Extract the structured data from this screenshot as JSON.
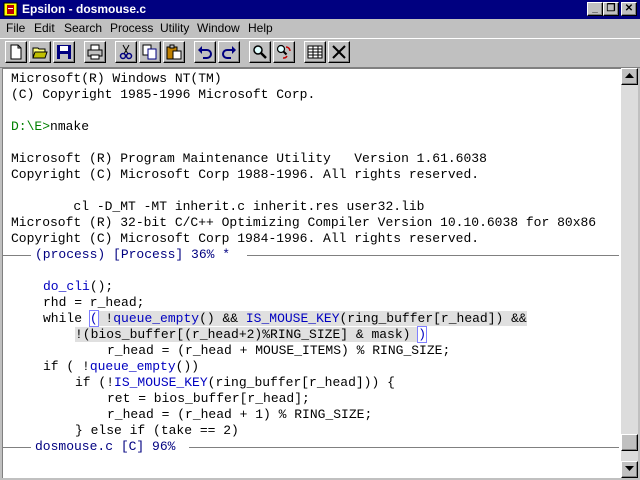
{
  "window": {
    "title": "Epsilon - dosmouse.c",
    "minimize_glyph": "_",
    "restore_glyph": "❐",
    "close_glyph": "✕"
  },
  "menu": [
    "File",
    "Edit",
    "Search",
    "Process",
    "Utility",
    "Window",
    "Help"
  ],
  "toolbar": {
    "buttons": [
      "new-file",
      "open-folder",
      "save",
      "print",
      "cut",
      "copy",
      "paste",
      "undo",
      "redo",
      "find",
      "find-replace",
      "columns",
      "close"
    ]
  },
  "process_buffer": {
    "lines": [
      "Microsoft(R) Windows NT(TM)",
      "(C) Copyright 1985-1996 Microsoft Corp.",
      "",
      "D:\\E>nmake",
      "",
      "Microsoft (R) Program Maintenance Utility   Version 1.61.6038",
      "Copyright (C) Microsoft Corp 1988-1996. All rights reserved.",
      "",
      "        cl -D_MT -MT inherit.c inherit.res user32.lib",
      "Microsoft (R) 32-bit C/C++ Optimizing Compiler Version 10.10.6038 for 80x86",
      "Copyright (C) Microsoft Corp 1984-1996. All rights reserved."
    ],
    "prompt": "D:\\E>",
    "command": "nmake",
    "mode_line": "(process) [Process] 36% *"
  },
  "source_buffer": {
    "mode_line": "dosmouse.c [C] 96%"
  },
  "code": {
    "l0_kw": "do_cli",
    "l0_rest": "();",
    "l1": "rhd = r_head;",
    "l2_a": "while ",
    "l2_b": "(",
    "l2_c": " !",
    "l2_d": "queue_empty",
    "l2_e": "() && ",
    "l2_f": "IS_MOUSE_KEY",
    "l2_g": "(ring_buffer[r_head]) &&",
    "l3_a": "!(bios_buffer[(r_head+2)%RING_SIZE] & mask) ",
    "l3_b": ")",
    "l4": "r_head = (r_head + MOUSE_ITEMS) % RING_SIZE;",
    "l5_a": "if ( !",
    "l5_b": "queue_empty",
    "l5_c": "())",
    "l6_a": "if (!",
    "l6_b": "IS_MOUSE_KEY",
    "l6_c": "(ring_buffer[r_head])) {",
    "l7": "ret = bios_buffer[r_head];",
    "l8": "r_head = (r_head + 1) % RING_SIZE;",
    "l9": "} else if (take == 2)"
  },
  "colors": {
    "titlebar": "#000080",
    "face": "#c0c0c0",
    "keyword": "#0000c0",
    "prompt": "#008000",
    "mode_line": "#000080"
  }
}
